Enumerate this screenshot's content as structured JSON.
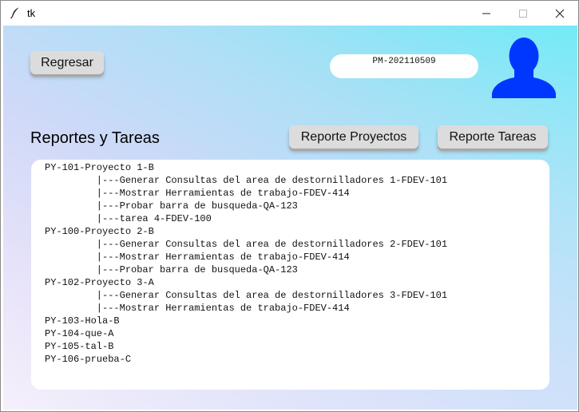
{
  "window": {
    "title": "tk",
    "icon": "feather-icon",
    "controls": [
      "minimize-icon",
      "maximize-icon",
      "close-icon"
    ]
  },
  "toolbar": {
    "back_label": "Regresar",
    "pm_code": "PM-202110509"
  },
  "avatar": {
    "icon": "user-avatar-icon",
    "color": "#0037ff"
  },
  "section": {
    "title": "Reportes y Tareas",
    "projects_report_label": "Reporte Proyectos",
    "tasks_report_label": "Reporte Tareas"
  },
  "report": {
    "lines": [
      "PY-101-Proyecto 1-B",
      "         |---Generar Consultas del area de destornilladores 1-FDEV-101",
      "         |---Mostrar Herramientas de trabajo-FDEV-414",
      "         |---Probar barra de busqueda-QA-123",
      "         |---tarea 4-FDEV-100",
      "PY-100-Proyecto 2-B",
      "         |---Generar Consultas del area de destornilladores 2-FDEV-101",
      "         |---Mostrar Herramientas de trabajo-FDEV-414",
      "         |---Probar barra de busqueda-QA-123",
      "PY-102-Proyecto 3-A",
      "         |---Generar Consultas del area de destornilladores 3-FDEV-101",
      "         |---Mostrar Herramientas de trabajo-FDEV-414",
      "PY-103-Hola-B",
      "PY-104-que-A",
      "PY-105-tal-B",
      "PY-106-prueba-C"
    ]
  }
}
